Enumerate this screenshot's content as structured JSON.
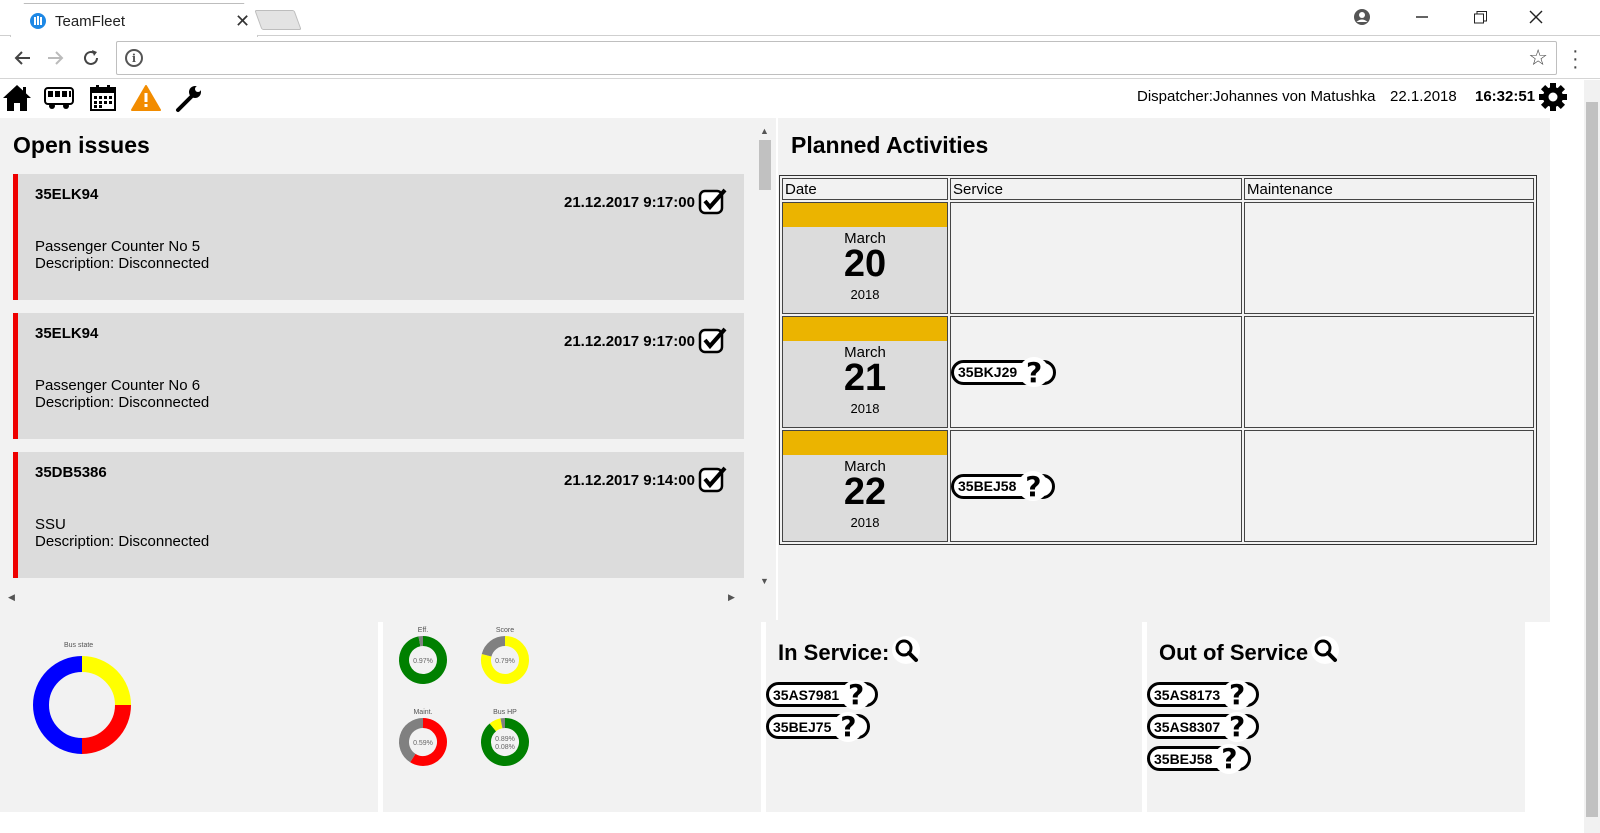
{
  "browser": {
    "tab_title": "TeamFleet",
    "tab_close": "✕",
    "window_buttons": [
      "account-icon",
      "minimize-icon",
      "restore-icon",
      "close-icon"
    ]
  },
  "header": {
    "dispatcher": "Dispatcher:Johannes von Matushka",
    "date": "22.1.2018",
    "time": "16:32:51",
    "toolbar_icons": [
      "home-icon",
      "bus-icon",
      "calendar-icon",
      "warning-icon",
      "wrench-icon"
    ]
  },
  "open_issues": {
    "title": "Open issues",
    "items": [
      {
        "vehicle": "35ELK94",
        "timestamp": "21.12.2017 9:17:00",
        "component": "Passenger Counter No 5",
        "description": "Description: Disconnected"
      },
      {
        "vehicle": "35ELK94",
        "timestamp": "21.12.2017 9:17:00",
        "component": "Passenger Counter No 6",
        "description": "Description: Disconnected"
      },
      {
        "vehicle": "35DB5386",
        "timestamp": "21.12.2017 9:14:00",
        "component": "SSU",
        "description": "Description: Disconnected"
      }
    ]
  },
  "planned": {
    "title": "Planned Activities",
    "columns": [
      "Date",
      "Service",
      "Maintenance"
    ],
    "rows": [
      {
        "month": "March",
        "day": "20",
        "year": "2018",
        "service": "",
        "maintenance": ""
      },
      {
        "month": "March",
        "day": "21",
        "year": "2018",
        "service": "35BKJ29",
        "maintenance": ""
      },
      {
        "month": "March",
        "day": "22",
        "year": "2018",
        "service": "35BEJ58",
        "maintenance": ""
      }
    ]
  },
  "bus_state": {
    "label": "Bus state",
    "segments": [
      {
        "color": "#0000ff",
        "value": 50
      },
      {
        "color": "#ffff00",
        "value": 25
      },
      {
        "color": "#ff0000",
        "value": 25
      }
    ]
  },
  "gauges": [
    {
      "label": "Eff.",
      "center": "0.97%",
      "segments": [
        {
          "color": "#008000",
          "value": 97
        },
        {
          "color": "#808080",
          "value": 3
        }
      ]
    },
    {
      "label": "Score",
      "center": "0.79%",
      "segments": [
        {
          "color": "#ffff00",
          "value": 79
        },
        {
          "color": "#808080",
          "value": 21
        }
      ]
    },
    {
      "label": "Maint.",
      "center": "0.59%",
      "segments": [
        {
          "color": "#ff0000",
          "value": 59
        },
        {
          "color": "#808080",
          "value": 41
        }
      ]
    },
    {
      "label": "Bus HP",
      "center": "0.89%\n0.08%",
      "segments": [
        {
          "color": "#008000",
          "value": 89
        },
        {
          "color": "#ffff00",
          "value": 8
        },
        {
          "color": "#808080",
          "value": 3
        }
      ]
    }
  ],
  "in_service": {
    "title": "In Service:",
    "vehicles": [
      "35AS7981",
      "35BEJ75"
    ]
  },
  "out_of_service": {
    "title": "Out of Service",
    "vehicles": [
      "35AS8173",
      "35AS8307",
      "35BEJ58"
    ]
  },
  "colors": {
    "accent_date": "#ebb400",
    "issue_border": "#e00000",
    "panel_bg": "#f2f2f2"
  }
}
